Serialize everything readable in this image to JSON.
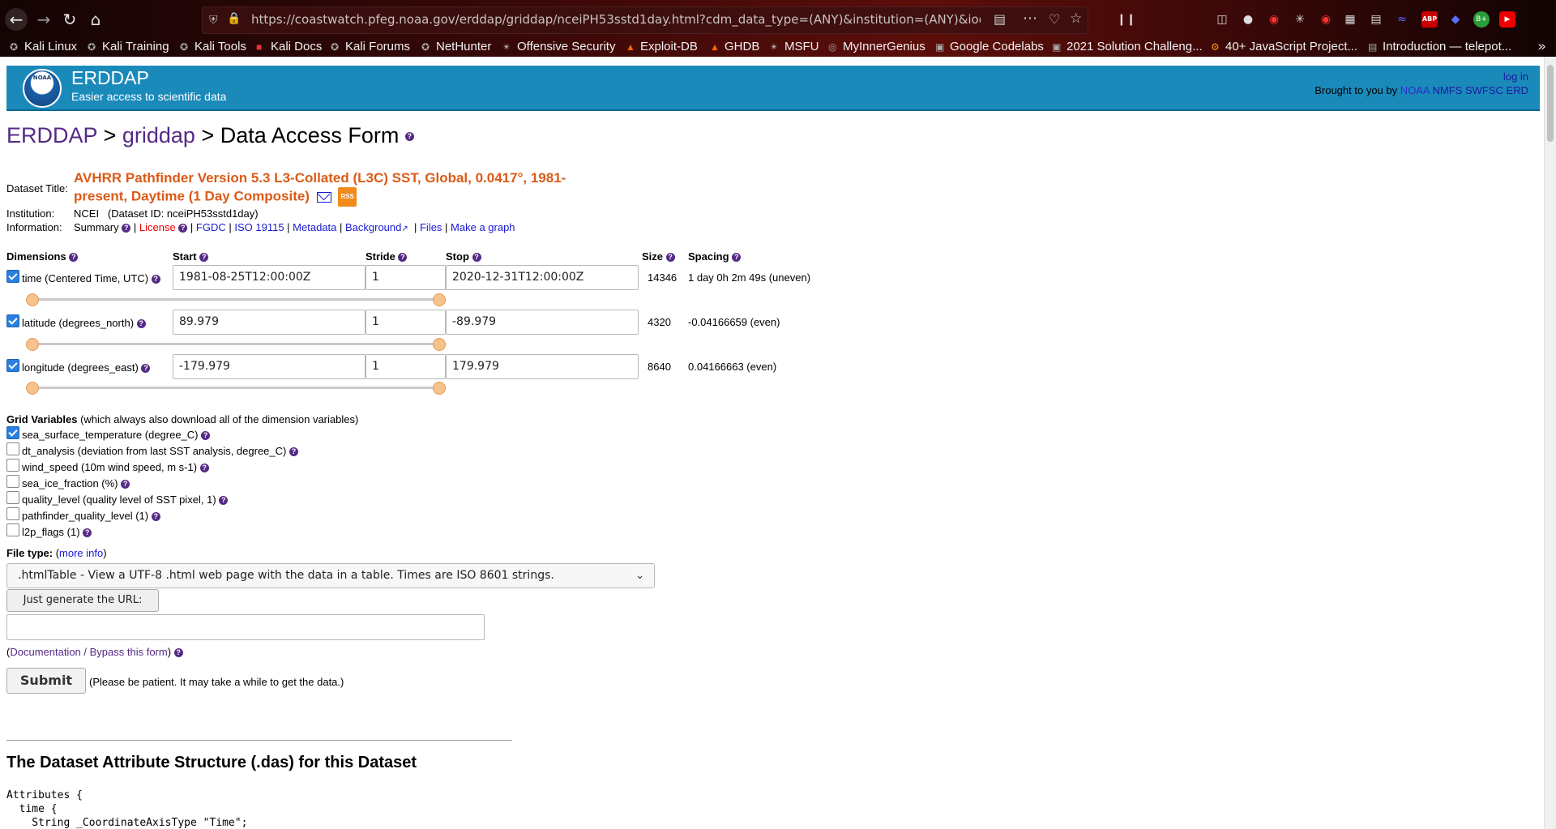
{
  "browser": {
    "url": "https://coastwatch.pfeg.noaa.gov/erddap/griddap/nceiPH53sstd1day.html?cdm_data_type=(ANY)&institution=(ANY)&ioos_catego",
    "bookmarks": [
      "Kali Linux",
      "Kali Training",
      "Kali Tools",
      "Kali Docs",
      "Kali Forums",
      "NetHunter",
      "Offensive Security",
      "Exploit-DB",
      "GHDB",
      "MSFU",
      "MyInnerGenius",
      "Google Codelabs",
      "2021 Solution Challeng...",
      "40+ JavaScript Project...",
      "Introduction — telepot..."
    ]
  },
  "banner": {
    "logo_text": "NOAA",
    "brand": "ERDDAP",
    "tagline": "Easier access to scientific data",
    "login": "log in",
    "brought_prefix": "Brought to you by",
    "brought_links": [
      "NOAA",
      "NMFS",
      "SWFSC",
      "ERD"
    ]
  },
  "breadcrumb": {
    "erddap": "ERDDAP",
    "sep1": ">",
    "griddap": "griddap",
    "sep2": ">",
    "page": "Data Access Form"
  },
  "dataset": {
    "title_label": "Dataset Title:",
    "title": "AVHRR Pathfinder Version 5.3 L3-Collated (L3C) SST, Global, 0.0417°, 1981-present, Daytime (1 Day Composite)",
    "rss": "RSS",
    "institution_label": "Institution:",
    "institution": "NCEI   (Dataset ID: nceiPH53sstd1day)",
    "information_label": "Information:",
    "links": {
      "summary": "Summary",
      "license": "License",
      "fgdc": "FGDC",
      "iso": "ISO 19115",
      "metadata": "Metadata",
      "background": "Background",
      "files": "Files",
      "graph": "Make a graph"
    }
  },
  "dimensions": {
    "headers": {
      "dimensions": "Dimensions",
      "start": "Start",
      "stride": "Stride",
      "stop": "Stop",
      "size": "Size",
      "spacing": "Spacing"
    },
    "rows": [
      {
        "name": "time (Centered Time, UTC)",
        "start": "1981-08-25T12:00:00Z",
        "stride": "1",
        "stop": "2020-12-31T12:00:00Z",
        "size": "14346",
        "spacing": "1 day 0h 2m 49s (uneven)",
        "checked": true,
        "slider_start": 0.0,
        "slider_stop": 1.0
      },
      {
        "name": "latitude (degrees_north)",
        "start": "89.979",
        "stride": "1",
        "stop": "-89.979",
        "size": "4320",
        "spacing": "-0.04166659 (even)",
        "checked": true,
        "slider_start": 0.0,
        "slider_stop": 1.0
      },
      {
        "name": "longitude (degrees_east)",
        "start": "-179.979",
        "stride": "1",
        "stop": "179.979",
        "size": "8640",
        "spacing": "0.04166663 (even)",
        "checked": true,
        "slider_start": 0.0,
        "slider_stop": 1.0
      }
    ]
  },
  "grid_variables": {
    "heading": "Grid Variables",
    "note": "(which always also download all of the dimension variables)",
    "items": [
      {
        "label": "sea_surface_temperature (degree_C)",
        "checked": true
      },
      {
        "label": "dt_analysis (deviation from last SST analysis, degree_C)",
        "checked": false
      },
      {
        "label": "wind_speed (10m wind speed, m s-1)",
        "checked": false
      },
      {
        "label": "sea_ice_fraction (%)",
        "checked": false
      },
      {
        "label": "quality_level (quality level of SST pixel, 1)",
        "checked": false
      },
      {
        "label": "pathfinder_quality_level (1)",
        "checked": false
      },
      {
        "label": "l2p_flags (1)",
        "checked": false
      }
    ]
  },
  "file_type": {
    "label": "File type:",
    "more_info": "more info",
    "selected": ".htmlTable - View a UTF-8 .html web page with the data in a table. Times are ISO 8601 strings."
  },
  "generate_url_button": "Just generate the URL:",
  "url_field_value": "",
  "doc_link": "Documentation / Bypass this form",
  "submit": {
    "label": "Submit",
    "note": "(Please be patient. It may take a while to get the data.)"
  },
  "das": {
    "title": "The Dataset Attribute Structure (.das) for this Dataset",
    "lines": [
      "Attributes {",
      "  time {",
      "    String _CoordinateAxisType \"Time\";"
    ]
  },
  "colors": {
    "banner": "#1a8aba",
    "title_orange": "#dc5a17",
    "breadcrumb_link": "#552a85",
    "slider_handle": "#f7c28c"
  }
}
